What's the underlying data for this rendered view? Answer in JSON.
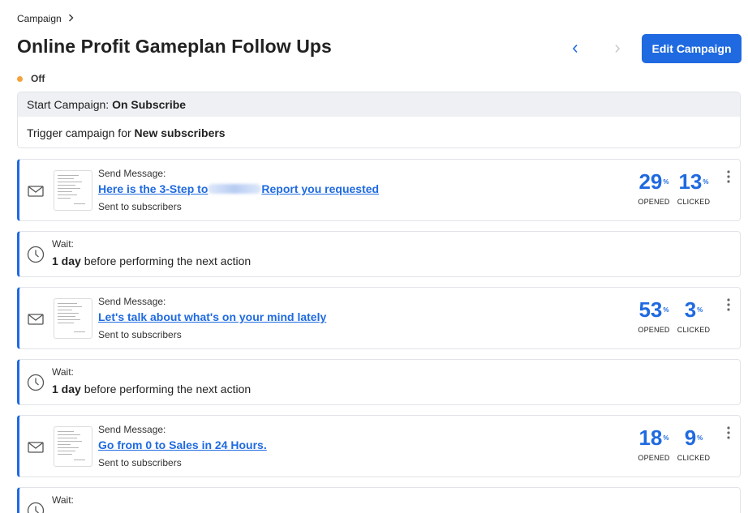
{
  "breadcrumb": {
    "label": "Campaign"
  },
  "page": {
    "title": "Online Profit Gameplan Follow Ups",
    "edit_label": "Edit Campaign"
  },
  "status": {
    "label": "Off",
    "color": "#f3a23d"
  },
  "trigger": {
    "start_prefix": "Start Campaign: ",
    "start_value": "On Subscribe",
    "body_prefix": "Trigger campaign for ",
    "body_value": "New subscribers"
  },
  "colors": {
    "accent": "#1f6ae0"
  },
  "steps": [
    {
      "type": "message",
      "icon": "envelope-icon",
      "label": "Send Message:",
      "link_before": "Here is the 3-Step to",
      "link_after": "Report you requested",
      "sent": "Sent to subscribers",
      "opened": "29",
      "clicked": "13",
      "pct": "%",
      "opened_label": "OPENED",
      "clicked_label": "CLICKED"
    },
    {
      "type": "wait",
      "icon": "clock-icon",
      "label": "Wait:",
      "duration": "1 day",
      "suffix": " before performing the next action"
    },
    {
      "type": "message",
      "icon": "envelope-icon",
      "label": "Send Message:",
      "link": "Let's talk about what's on your mind lately",
      "sent": "Sent to subscribers",
      "opened": "53",
      "clicked": "3",
      "pct": "%",
      "opened_label": "OPENED",
      "clicked_label": "CLICKED"
    },
    {
      "type": "wait",
      "icon": "clock-icon",
      "label": "Wait:",
      "duration": "1 day",
      "suffix": " before performing the next action"
    },
    {
      "type": "message",
      "icon": "envelope-icon",
      "label": "Send Message:",
      "link": "Go from 0 to Sales in 24 Hours.",
      "sent": "Sent to subscribers",
      "opened": "18",
      "clicked": "9",
      "pct": "%",
      "opened_label": "OPENED",
      "clicked_label": "CLICKED"
    },
    {
      "type": "wait",
      "icon": "clock-icon",
      "label": "Wait:"
    }
  ]
}
